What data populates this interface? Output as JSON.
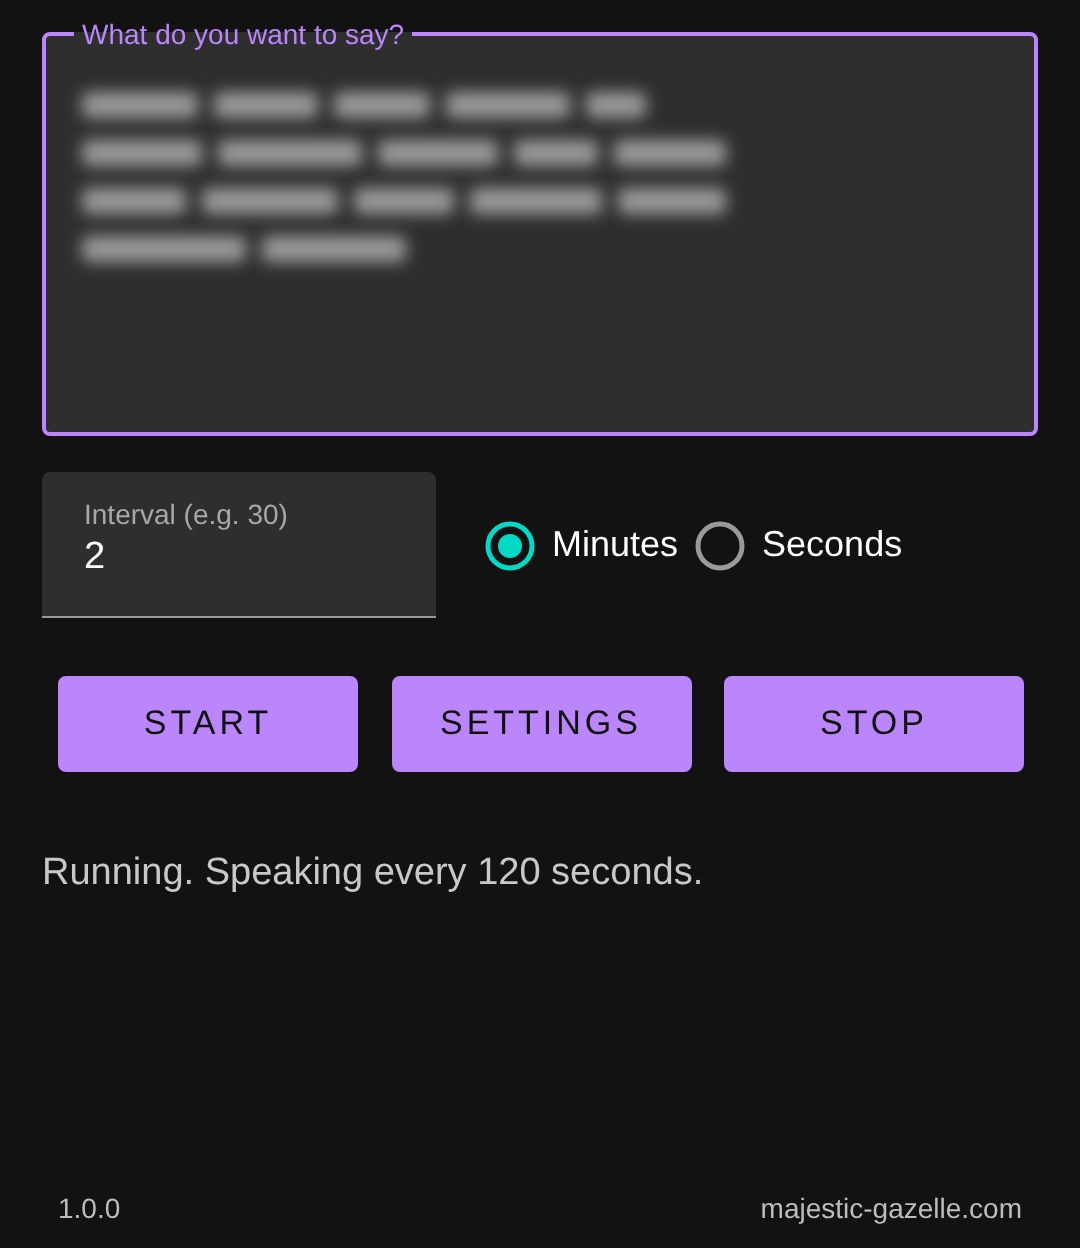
{
  "message_field": {
    "label": "What do you want to say?",
    "kind": "blurred"
  },
  "interval_field": {
    "label": "Interval (e.g. 30)",
    "value": "2"
  },
  "units": [
    {
      "label": "Minutes",
      "selected": true
    },
    {
      "label": "Seconds",
      "selected": false
    }
  ],
  "buttons": [
    "START",
    "SETTINGS",
    "STOP"
  ],
  "status": "Running. Speaking every 120 seconds.",
  "footer": {
    "version": "1.0.0",
    "site": "majestic-gazelle.com"
  }
}
